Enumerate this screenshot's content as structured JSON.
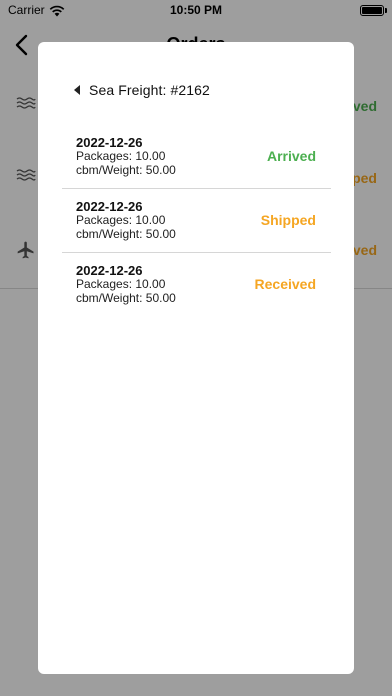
{
  "status_bar": {
    "carrier": "Carrier",
    "time": "10:50 PM"
  },
  "background": {
    "title": "Orders",
    "rows": [
      {
        "icon": "waves-icon",
        "status": "Arrived",
        "color": "#4caf50"
      },
      {
        "icon": "waves-icon",
        "status": "Shipped",
        "color": "#f5a623"
      },
      {
        "icon": "airplane-icon",
        "status": "Received",
        "color": "#f5a623"
      }
    ]
  },
  "modal": {
    "title": "Sea Freight: #2162",
    "entries": [
      {
        "date": "2022-12-26",
        "packages": "Packages: 10.00",
        "weight": "cbm/Weight: 50.00",
        "status": "Arrived",
        "color": "#4caf50"
      },
      {
        "date": "2022-12-26",
        "packages": "Packages: 10.00",
        "weight": "cbm/Weight: 50.00",
        "status": "Shipped",
        "color": "#f5a623"
      },
      {
        "date": "2022-12-26",
        "packages": "Packages: 10.00",
        "weight": "cbm/Weight: 50.00",
        "status": "Received",
        "color": "#f5a623"
      }
    ]
  }
}
